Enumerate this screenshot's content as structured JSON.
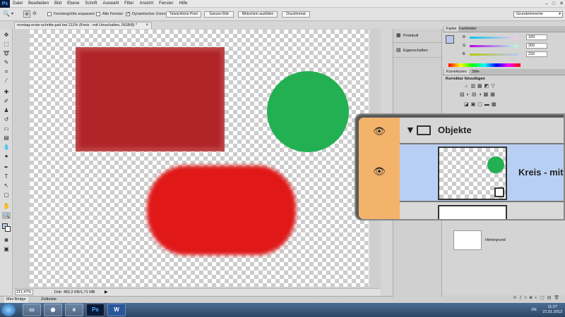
{
  "app": {
    "logo": "Ps"
  },
  "menu": [
    "Datei",
    "Bearbeiten",
    "Bild",
    "Ebene",
    "Schrift",
    "Auswahl",
    "Filter",
    "Ansicht",
    "Fenster",
    "Hilfe"
  ],
  "window_controls": [
    "–",
    "□",
    "✕"
  ],
  "options": {
    "zoom_in_icon": "zoom-in-icon",
    "fit_window_label": "Fenstergröße anpassen",
    "all_windows_label": "Alle Fenster",
    "dynamic_zoom_label": "Dynamischer Zoom",
    "dynamic_zoom_checked": true,
    "actual_pixels": "Tatsächliche Pixel",
    "fit_screen": "Ganzes Bild",
    "fill_screen": "Bildschirm ausfüllen",
    "print_size": "Druckformat",
    "workspace": "Grundelemente"
  },
  "document": {
    "tab_title": "montag-erste-schritte.psd bei 211% (Kreis - mit Umschalten, RGB/8) *",
    "tab_close": "×"
  },
  "status": {
    "zoom": "211,47%",
    "doc_info": "Dok: 482,2 KB/1,71 MB",
    "arrow": "▶"
  },
  "bottom_tabs": [
    "Mini Bridge",
    "Zeitleiste"
  ],
  "mid_panels": [
    {
      "label": "Protokoll",
      "icon": "history-icon"
    },
    {
      "label": "Eigenschaften",
      "icon": "properties-icon"
    }
  ],
  "color_panel": {
    "tabs": [
      "Farbe",
      "Farbfelder"
    ],
    "channels": [
      {
        "label": "R",
        "value": "183",
        "color": "#d04040"
      },
      {
        "label": "G",
        "value": "200",
        "color": "#40b040"
      },
      {
        "label": "B",
        "value": "232",
        "color": "#4060d0"
      }
    ]
  },
  "adjustments_panel": {
    "tabs": [
      "Korrekturen",
      "Stile"
    ],
    "heading": "Korrektur hinzufügen"
  },
  "layers": {
    "group_name": "Objekte",
    "selected_layer": "Kreis - mit U",
    "background_layer": "Hintergrund"
  },
  "canvas_colors": {
    "rect": "#b02428",
    "circle": "#22b052",
    "blob": "#e01818"
  },
  "taskbar": {
    "apps": [
      "Explorer",
      "Firefox",
      "IE",
      "Ps",
      "W"
    ],
    "lang": "DE",
    "time": "11:27",
    "date": "21.01.2013"
  }
}
